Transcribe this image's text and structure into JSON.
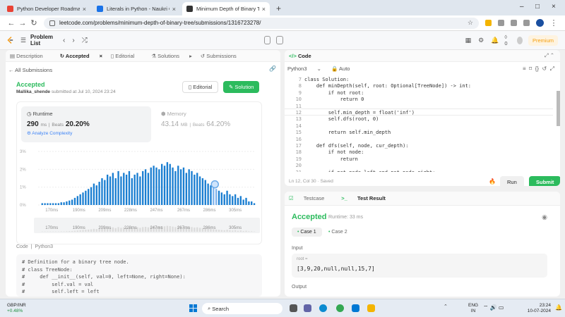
{
  "tabs": [
    {
      "title": "Python Developer Roadmap",
      "color": "#e94235"
    },
    {
      "title": "Literals in Python - Naukri Code",
      "color": "#1a73e8"
    },
    {
      "title": "Minimum Depth of Binary Tree",
      "color": "#333333"
    }
  ],
  "url": "leetcode.com/problems/minimum-depth-of-binary-tree/submissions/1316723278/",
  "header": {
    "problem_list": "Problem List",
    "coins": "0",
    "premium": "Premium"
  },
  "left_tabs": [
    "Description",
    "Accepted",
    "Editorial",
    "Solutions",
    "Submissions"
  ],
  "back": "All Submissions",
  "status": "Accepted",
  "author": "Mallika_shende",
  "submitted": "submitted at Jul 10, 2024 23:24",
  "editorial_btn": "Editorial",
  "solution_btn": "Solution",
  "runtime": {
    "label": "Runtime",
    "value": "290",
    "unit": "ms",
    "beats_label": "Beats",
    "beats": "20.20%",
    "analyze": "Analyze Complexity"
  },
  "memory": {
    "label": "Memory",
    "value": "43.14",
    "unit": "MB",
    "beats_label": "Beats",
    "beats": "64.20%"
  },
  "chart_data": {
    "type": "bar",
    "y_ticks": [
      "0%",
      "1%",
      "2%",
      "3%"
    ],
    "ylim": [
      0,
      3
    ],
    "x_ticks": [
      "170ms",
      "190ms",
      "209ms",
      "228ms",
      "247ms",
      "267ms",
      "286ms",
      "305ms"
    ],
    "xlim": [
      160,
      320
    ],
    "highlight": {
      "x": 290,
      "label": "you"
    },
    "x": [
      163,
      165,
      167,
      169,
      171,
      173,
      175,
      177,
      179,
      181,
      183,
      185,
      187,
      189,
      191,
      193,
      195,
      197,
      199,
      201,
      203,
      205,
      207,
      209,
      211,
      213,
      215,
      217,
      219,
      221,
      223,
      225,
      227,
      229,
      231,
      233,
      235,
      237,
      239,
      241,
      243,
      245,
      247,
      249,
      251,
      253,
      255,
      257,
      259,
      261,
      263,
      265,
      267,
      269,
      271,
      273,
      275,
      277,
      279,
      281,
      283,
      285,
      287,
      289,
      291,
      293,
      295,
      297,
      299,
      301,
      303,
      305,
      307,
      309,
      311,
      313,
      315,
      317,
      319
    ],
    "values": [
      0.1,
      0.1,
      0.1,
      0.1,
      0.1,
      0.1,
      0.1,
      0.15,
      0.15,
      0.2,
      0.25,
      0.3,
      0.4,
      0.5,
      0.6,
      0.7,
      0.8,
      0.9,
      1.0,
      1.2,
      1.1,
      1.3,
      1.5,
      1.4,
      1.7,
      1.6,
      1.8,
      1.5,
      1.9,
      1.6,
      1.8,
      1.7,
      1.9,
      1.5,
      1.7,
      1.8,
      1.6,
      1.9,
      2.0,
      1.8,
      2.1,
      2.2,
      2.1,
      2.0,
      2.3,
      2.2,
      2.4,
      2.3,
      2.1,
      1.9,
      2.2,
      2.0,
      2.1,
      1.8,
      2.0,
      1.9,
      1.7,
      1.8,
      1.6,
      1.5,
      1.4,
      1.2,
      1.1,
      1.0,
      0.9,
      0.8,
      0.7,
      0.6,
      0.8,
      0.6,
      0.5,
      0.6,
      0.4,
      0.5,
      0.3,
      0.4,
      0.2,
      0.2,
      0.1
    ]
  },
  "code_lang": "Python3",
  "code_label": "Code",
  "sub_code": [
    "# Definition for a binary tree node.",
    "# class TreeNode:",
    "#     def __init__(self, val=0, left=None, right=None):",
    "#         self.val = val",
    "#         self.left = left"
  ],
  "editor": {
    "title": "Code",
    "lang": "Python3",
    "mode": "Auto",
    "lines": [
      {
        "n": "7",
        "t": "class Solution:"
      },
      {
        "n": "8",
        "t": "    def minDepth(self, root: Optional[TreeNode]) -> int:"
      },
      {
        "n": "9",
        "t": "        if not root:"
      },
      {
        "n": "10",
        "t": "            return 0"
      },
      {
        "n": "11",
        "t": ""
      },
      {
        "n": "12",
        "t": "        self.min_depth = float('inf')"
      },
      {
        "n": "13",
        "t": "        self.dfs(root, 0)"
      },
      {
        "n": "14",
        "t": ""
      },
      {
        "n": "15",
        "t": "        return self.min_depth"
      },
      {
        "n": "16",
        "t": ""
      },
      {
        "n": "17",
        "t": "    def dfs(self, node, cur_depth):"
      },
      {
        "n": "18",
        "t": "        if not node:"
      },
      {
        "n": "19",
        "t": "            return"
      },
      {
        "n": "20",
        "t": ""
      },
      {
        "n": "21",
        "t": "        if not node.left and not node.right:"
      }
    ],
    "status": "Ln 12, Col 30  ·  Saved",
    "run": "Run",
    "submit": "Submit"
  },
  "bottom_tabs": [
    "Testcase",
    "Test Result"
  ],
  "result": {
    "status": "Accepted",
    "runtime": "Runtime: 33 ms",
    "case1": "Case 1",
    "case2": "Case 2",
    "input_label": "Input",
    "input_key": "root =",
    "input_value": "[3,9,20,null,null,15,7]",
    "output_label": "Output"
  },
  "taskbar": {
    "stock_name": "GBP/INR",
    "stock_change": "+0.48%",
    "search": "Search",
    "lang1": "ENG",
    "lang2": "IN",
    "time": "23:24",
    "date": "10-07-2024"
  }
}
